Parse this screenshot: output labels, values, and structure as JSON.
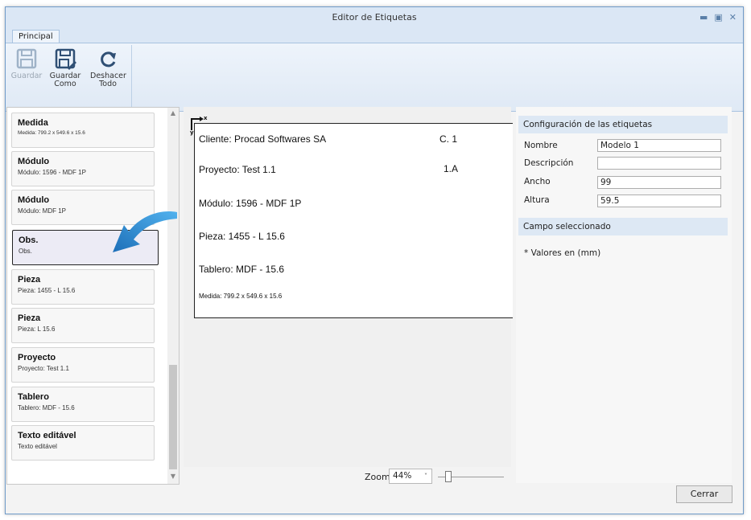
{
  "window": {
    "title": "Editor de Etiquetas"
  },
  "tabs": [
    {
      "label": "Principal"
    }
  ],
  "ribbon": {
    "buttons": [
      {
        "label": "Guardar",
        "icon": "save-icon",
        "enabled": false
      },
      {
        "label": "Guardar Como",
        "icon": "save-as-icon",
        "enabled": true
      },
      {
        "label": "Deshacer Todo",
        "icon": "undo-all-icon",
        "enabled": true
      }
    ]
  },
  "fields_list": {
    "items": [
      {
        "title": "Medida",
        "subtitle": "Medida: 799.2 x 549.6 x 15.6"
      },
      {
        "title": "Módulo",
        "subtitle": "Módulo: 1596 - MDF 1P"
      },
      {
        "title": "Módulo",
        "subtitle": "Módulo: MDF 1P"
      },
      {
        "title": "Obs.",
        "subtitle": "Obs.",
        "selected": true
      },
      {
        "title": "Pieza",
        "subtitle": "Pieza: 1455 - L 15.6"
      },
      {
        "title": "Pieza",
        "subtitle": "Pieza: L 15.6"
      },
      {
        "title": "Proyecto",
        "subtitle": "Proyecto: Test 1.1"
      },
      {
        "title": "Tablero",
        "subtitle": "Tablero: MDF - 15.6"
      },
      {
        "title": "Texto editável",
        "subtitle": "Texto editável"
      }
    ]
  },
  "label_preview": {
    "origin_x": "x",
    "origin_y": "y",
    "texts": [
      {
        "text": "Cliente: Procad Softwares SA"
      },
      {
        "text": "C. 1"
      },
      {
        "text": "Proyecto: Test 1.1"
      },
      {
        "text": "1.A"
      },
      {
        "text": "Módulo: 1596 - MDF 1P"
      },
      {
        "text": "Pieza: 1455 - L 15.6"
      },
      {
        "text": "Tablero: MDF - 15.6"
      },
      {
        "text": "Medida: 799.2 x 549.6 x 15.6"
      }
    ]
  },
  "zoom": {
    "label": "Zoom",
    "value": "44%"
  },
  "config": {
    "header": "Configuración de las etiquetas",
    "fields": [
      {
        "label": "Nombre",
        "value": "Modelo 1"
      },
      {
        "label": "Descripción",
        "value": ""
      },
      {
        "label": "Ancho",
        "value": "99"
      },
      {
        "label": "Altura",
        "value": "59.5"
      }
    ],
    "selected_header": "Campo seleccionado",
    "note": "* Valores en (mm)"
  },
  "footer": {
    "close_label": "Cerrar"
  },
  "colors": {
    "accent": "#2f8fd8",
    "ribbon": "#dfe9f5",
    "header": "#dde8f4"
  }
}
